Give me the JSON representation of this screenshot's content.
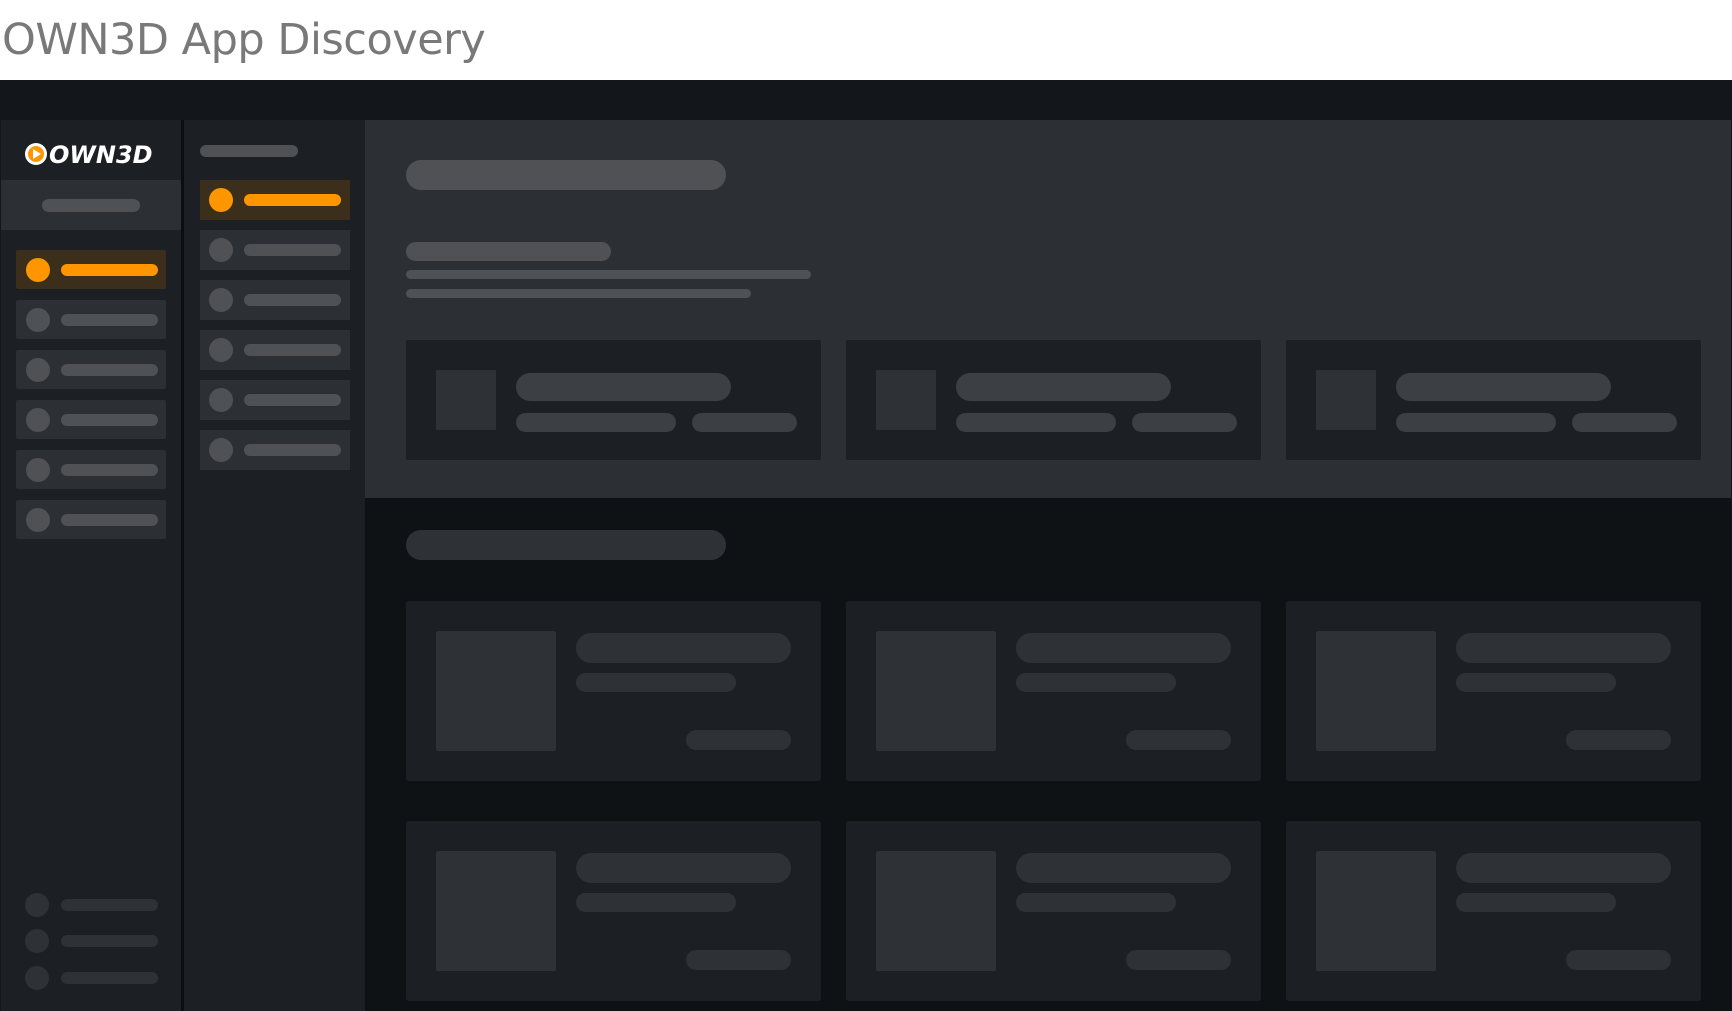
{
  "page": {
    "title": "OWN3D App Discovery"
  },
  "brand": {
    "logo_text": "OWN3D",
    "accent_color": "#ff9600"
  },
  "sidebar": {
    "user_placeholder": true,
    "items": [
      {
        "active": true
      },
      {
        "active": false
      },
      {
        "active": false
      },
      {
        "active": false
      },
      {
        "active": false
      },
      {
        "active": false
      }
    ],
    "footer_items": 3
  },
  "subnav": {
    "items": [
      {
        "active": true
      },
      {
        "active": false
      },
      {
        "active": false
      },
      {
        "active": false
      },
      {
        "active": false
      },
      {
        "active": false
      }
    ]
  },
  "main": {
    "featured_cards": 3,
    "app_cards": 6
  },
  "colors": {
    "frame_bg": "#13171b",
    "sidebar_bg": "#1c1f24",
    "panel_bg": "#2c3035",
    "placeholder": "#4f5155",
    "active_item_bg": "#3b2f1c"
  }
}
